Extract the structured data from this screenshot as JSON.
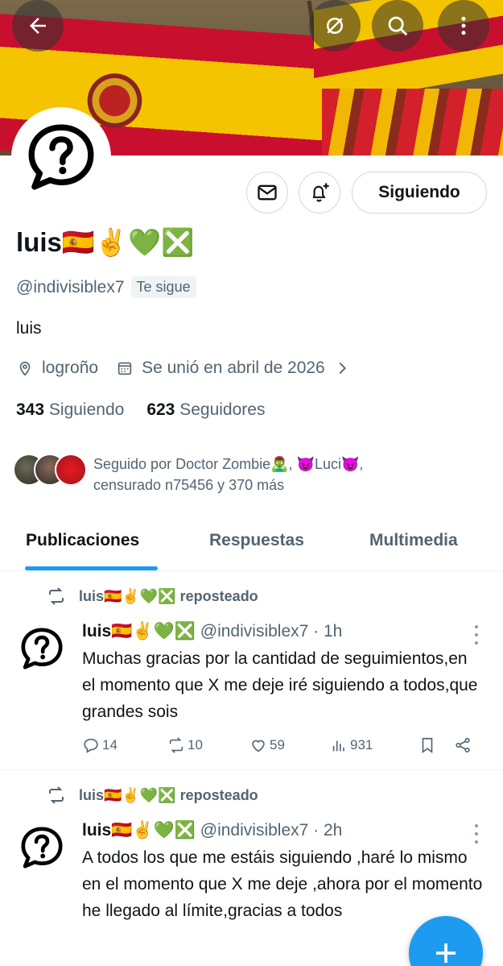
{
  "header": {
    "back_icon": "arrow-left-icon",
    "grok_icon": "slashed-circle-icon",
    "search_icon": "search-icon",
    "more_icon": "vertical-dots-icon"
  },
  "profile": {
    "follow_button_label": "Siguiendo",
    "name": "luis🇪🇸✌️💚❎",
    "handle": "@indivisiblex7",
    "follows_you": "Te sigue",
    "bio": "luis",
    "location": "logroño",
    "joined": "Se unió en abril de 2026",
    "following_count": "343",
    "following_label": "Siguiendo",
    "followers_count": "623",
    "followers_label": "Seguidores",
    "followed_by_text": "Seguido por Doctor Zombie🧟‍♂️, 😈Luci😈, censurado n75456 y 370 más"
  },
  "tabs": [
    {
      "label": "Publicaciones"
    },
    {
      "label": "Respuestas"
    },
    {
      "label": "Multimedia"
    }
  ],
  "posts": [
    {
      "repost_label": "luis🇪🇸✌️💚❎ reposteado",
      "name": "luis🇪🇸✌️💚❎",
      "handle_time": "@indivisiblex7 · 1h",
      "text": "Muchas gracias por la cantidad de seguimientos,en el momento que X me deje iré siguiendo a todos,que grandes sois",
      "replies": "14",
      "reposts": "10",
      "likes": "59",
      "views": "931"
    },
    {
      "repost_label": "luis🇪🇸✌️💚❎ reposteado",
      "name": "luis🇪🇸✌️💚❎",
      "handle_time": "@indivisiblex7 · 2h",
      "text": "A todos los que me estáis siguiendo ,haré lo mismo en el momento que X me deje ,ahora por el momento he llegado al límite,gracias a todos"
    }
  ],
  "colors": {
    "accent": "#1d9bf0",
    "text_primary": "#0f1419",
    "text_secondary": "#536471"
  }
}
